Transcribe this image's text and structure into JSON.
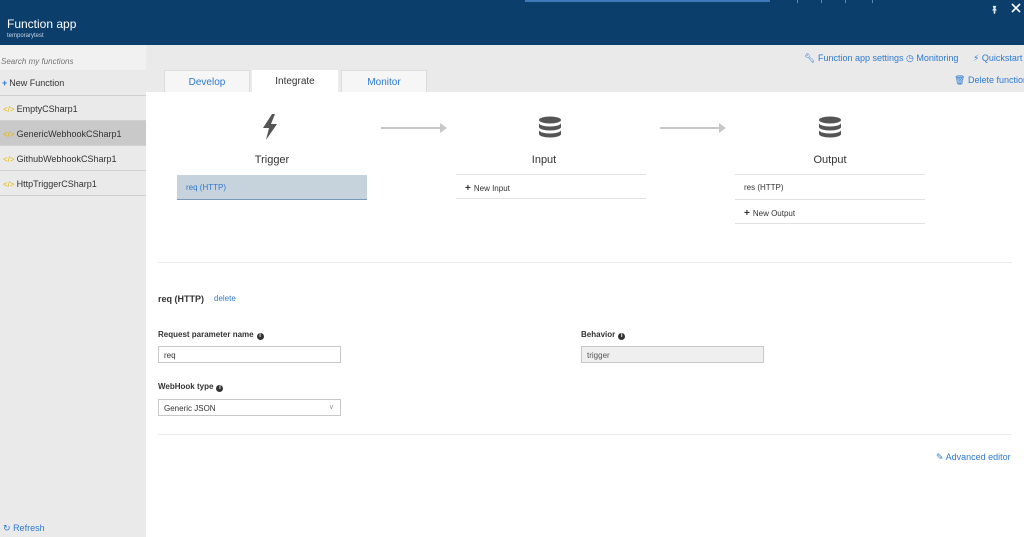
{
  "header": {
    "title": "Function app",
    "subtitle": "temporarytest",
    "pin_icon": "pin-icon",
    "close_icon": "close-icon"
  },
  "sidebar": {
    "search_placeholder": "Search my functions",
    "new_function_label": "New Function",
    "functions": [
      {
        "name": "EmptyCSharp1",
        "active": false
      },
      {
        "name": "GenericWebhookCSharp1",
        "active": true
      },
      {
        "name": "GithubWebhookCSharp1",
        "active": false
      },
      {
        "name": "HttpTriggerCSharp1",
        "active": false
      }
    ],
    "refresh_label": "Refresh"
  },
  "actions": {
    "settings_label": "Function app settings",
    "monitoring_label": "Monitoring",
    "quickstart_label": "Quickstart",
    "delete_label": "Delete function"
  },
  "tabs": [
    {
      "label": "Develop",
      "active": false
    },
    {
      "label": "Integrate",
      "active": true
    },
    {
      "label": "Monitor",
      "active": false
    }
  ],
  "diagram": {
    "trigger": {
      "title": "Trigger",
      "items": [
        "req (HTTP)"
      ]
    },
    "input": {
      "title": "Input",
      "add_label": "New Input"
    },
    "output": {
      "title": "Output",
      "items": [
        "res (HTTP)"
      ],
      "add_label": "New Output"
    }
  },
  "details": {
    "binding_title": "req (HTTP)",
    "delete_label": "delete",
    "request_param_label": "Request parameter name",
    "request_param_value": "req",
    "behavior_label": "Behavior",
    "behavior_value": "trigger",
    "webhook_type_label": "WebHook type",
    "webhook_type_value": "Generic JSON"
  },
  "advanced_editor_label": "Advanced editor",
  "colors": {
    "header_bg": "#0b3e6b",
    "accent": "#2e7ad1",
    "sidebar_bg": "#eaeaea",
    "selected_slot": "#c6d2dc",
    "function_icon": "#e4b700"
  }
}
